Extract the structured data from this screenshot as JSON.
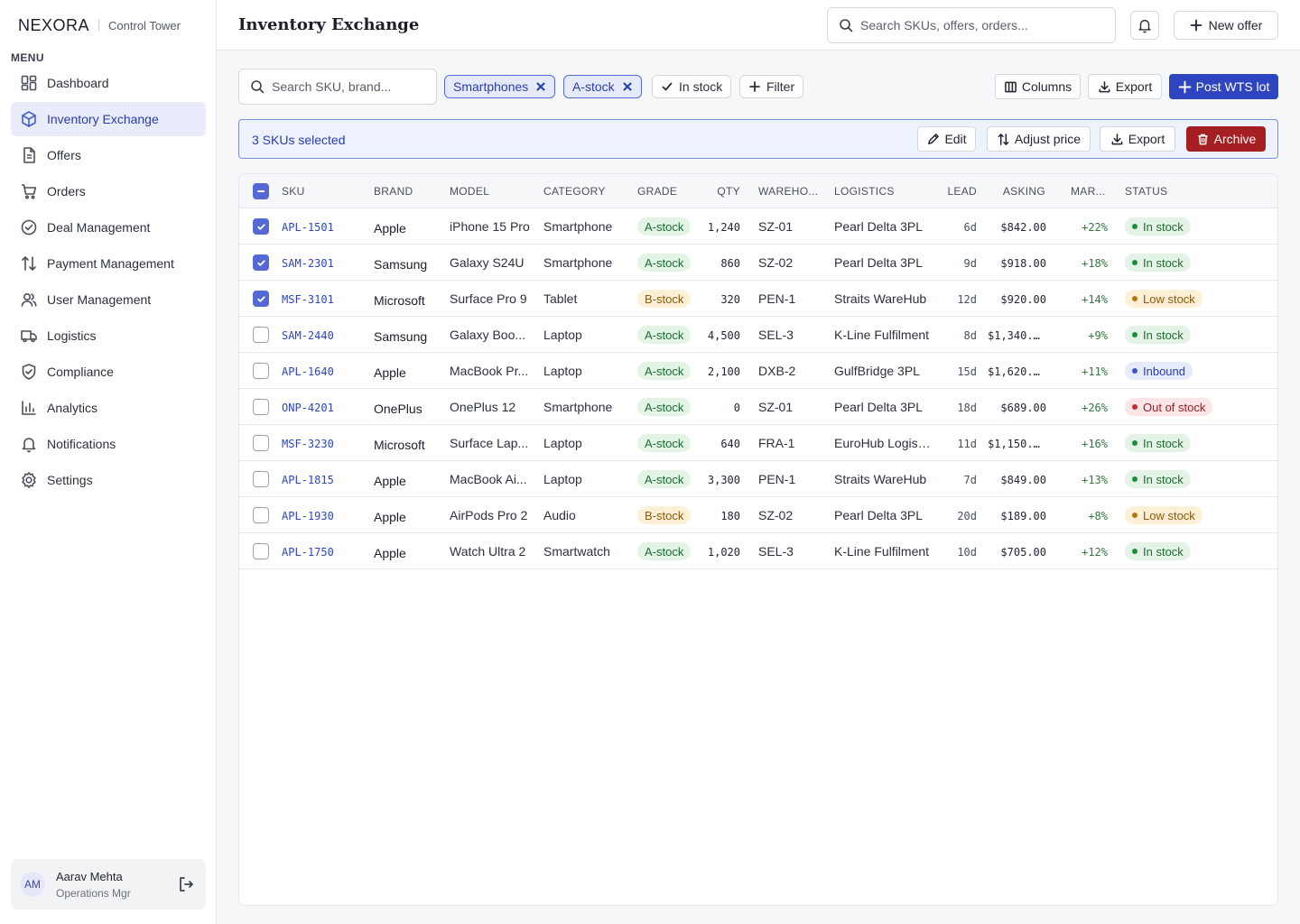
{
  "sidebar": {
    "brand": "NEXORA",
    "brand_sub": "Control Tower",
    "menu_label": "MENU",
    "items": [
      {
        "label": "Dashboard",
        "icon": "dashboard-icon",
        "active": false
      },
      {
        "label": "Inventory Exchange",
        "icon": "box-icon",
        "active": true
      },
      {
        "label": "Offers",
        "icon": "document-icon",
        "active": false
      },
      {
        "label": "Orders",
        "icon": "cart-icon",
        "active": false
      },
      {
        "label": "Deal Management",
        "icon": "check-circle-icon",
        "active": false
      },
      {
        "label": "Payment Management",
        "icon": "transfer-icon",
        "active": false
      },
      {
        "label": "User Management",
        "icon": "users-icon",
        "active": false
      },
      {
        "label": "Logistics",
        "icon": "truck-icon",
        "active": false
      },
      {
        "label": "Compliance",
        "icon": "shield-icon",
        "active": false
      },
      {
        "label": "Analytics",
        "icon": "bar-chart-icon",
        "active": false
      },
      {
        "label": "Notifications",
        "icon": "bell-icon",
        "active": false
      },
      {
        "label": "Settings",
        "icon": "gear-icon",
        "active": false
      }
    ],
    "user": {
      "initials": "AM",
      "name": "Aarav Mehta",
      "role": "Operations Mgr"
    }
  },
  "header": {
    "title": "Inventory Exchange",
    "search_placeholder": "Search SKUs, offers, orders...",
    "new_offer_label": "New offer"
  },
  "toolbar": {
    "search_placeholder": "Search SKU, brand...",
    "chips": [
      {
        "label": "Smartphones",
        "applied": true
      },
      {
        "label": "A-stock",
        "applied": true
      }
    ],
    "in_stock_label": "In stock",
    "filter_label": "Filter",
    "columns_label": "Columns",
    "export_label": "Export",
    "post_label": "Post WTS lot"
  },
  "selection": {
    "text": "3 SKUs selected",
    "edit_label": "Edit",
    "adjust_label": "Adjust price",
    "export_label": "Export",
    "archive_label": "Archive"
  },
  "colors": {
    "accent": "#2f45c0",
    "danger": "#a41e22",
    "grade_a_bg": "#e3f4e6",
    "grade_a_fg": "#1f6b32",
    "grade_b_bg": "#fdf0d6",
    "grade_b_fg": "#8a5a0c"
  },
  "table": {
    "columns": [
      "SKU",
      "BRAND",
      "MODEL",
      "CATEGORY",
      "GRADE",
      "QTY",
      "WAREHO...",
      "LOGISTICS",
      "LEAD",
      "ASKING",
      "MAR...",
      "STATUS"
    ],
    "rows": [
      {
        "checked": true,
        "sku": "APL-1501",
        "brand": "Apple",
        "model": "iPhone 15 Pro",
        "category": "Smartphone",
        "grade": "A-stock",
        "qty": "1,240",
        "warehouse": "SZ-01",
        "logistics": "Pearl Delta 3PL",
        "lead": "6d",
        "asking": "$842.00",
        "margin": "+22%",
        "status": "In stock"
      },
      {
        "checked": true,
        "sku": "SAM-2301",
        "brand": "Samsung",
        "model": "Galaxy S24U",
        "category": "Smartphone",
        "grade": "A-stock",
        "qty": "860",
        "warehouse": "SZ-02",
        "logistics": "Pearl Delta 3PL",
        "lead": "9d",
        "asking": "$918.00",
        "margin": "+18%",
        "status": "In stock"
      },
      {
        "checked": true,
        "sku": "MSF-3101",
        "brand": "Microsoft",
        "model": "Surface Pro 9",
        "category": "Tablet",
        "grade": "B-stock",
        "qty": "320",
        "warehouse": "PEN-1",
        "logistics": "Straits WareHub",
        "lead": "12d",
        "asking": "$920.00",
        "margin": "+14%",
        "status": "Low stock"
      },
      {
        "checked": false,
        "sku": "SAM-2440",
        "brand": "Samsung",
        "model": "Galaxy Boo...",
        "category": "Laptop",
        "grade": "A-stock",
        "qty": "4,500",
        "warehouse": "SEL-3",
        "logistics": "K-Line Fulfilment",
        "lead": "8d",
        "asking": "$1,340...",
        "margin": "+9%",
        "status": "In stock"
      },
      {
        "checked": false,
        "sku": "APL-1640",
        "brand": "Apple",
        "model": "MacBook Pr...",
        "category": "Laptop",
        "grade": "A-stock",
        "qty": "2,100",
        "warehouse": "DXB-2",
        "logistics": "GulfBridge 3PL",
        "lead": "15d",
        "asking": "$1,620...",
        "margin": "+11%",
        "status": "Inbound"
      },
      {
        "checked": false,
        "sku": "ONP-4201",
        "brand": "OnePlus",
        "model": "OnePlus 12",
        "category": "Smartphone",
        "grade": "A-stock",
        "qty": "0",
        "warehouse": "SZ-01",
        "logistics": "Pearl Delta 3PL",
        "lead": "18d",
        "asking": "$689.00",
        "margin": "+26%",
        "status": "Out of stock"
      },
      {
        "checked": false,
        "sku": "MSF-3230",
        "brand": "Microsoft",
        "model": "Surface Lap...",
        "category": "Laptop",
        "grade": "A-stock",
        "qty": "640",
        "warehouse": "FRA-1",
        "logistics": "EuroHub Logist...",
        "lead": "11d",
        "asking": "$1,150...",
        "margin": "+16%",
        "status": "In stock"
      },
      {
        "checked": false,
        "sku": "APL-1815",
        "brand": "Apple",
        "model": "MacBook Ai...",
        "category": "Laptop",
        "grade": "A-stock",
        "qty": "3,300",
        "warehouse": "PEN-1",
        "logistics": "Straits WareHub",
        "lead": "7d",
        "asking": "$849.00",
        "margin": "+13%",
        "status": "In stock"
      },
      {
        "checked": false,
        "sku": "APL-1930",
        "brand": "Apple",
        "model": "AirPods Pro 2",
        "category": "Audio",
        "grade": "B-stock",
        "qty": "180",
        "warehouse": "SZ-02",
        "logistics": "Pearl Delta 3PL",
        "lead": "20d",
        "asking": "$189.00",
        "margin": "+8%",
        "status": "Low stock"
      },
      {
        "checked": false,
        "sku": "APL-1750",
        "brand": "Apple",
        "model": "Watch Ultra 2",
        "category": "Smartwatch",
        "grade": "A-stock",
        "qty": "1,020",
        "warehouse": "SEL-3",
        "logistics": "K-Line Fulfilment",
        "lead": "10d",
        "asking": "$705.00",
        "margin": "+12%",
        "status": "In stock"
      }
    ]
  }
}
